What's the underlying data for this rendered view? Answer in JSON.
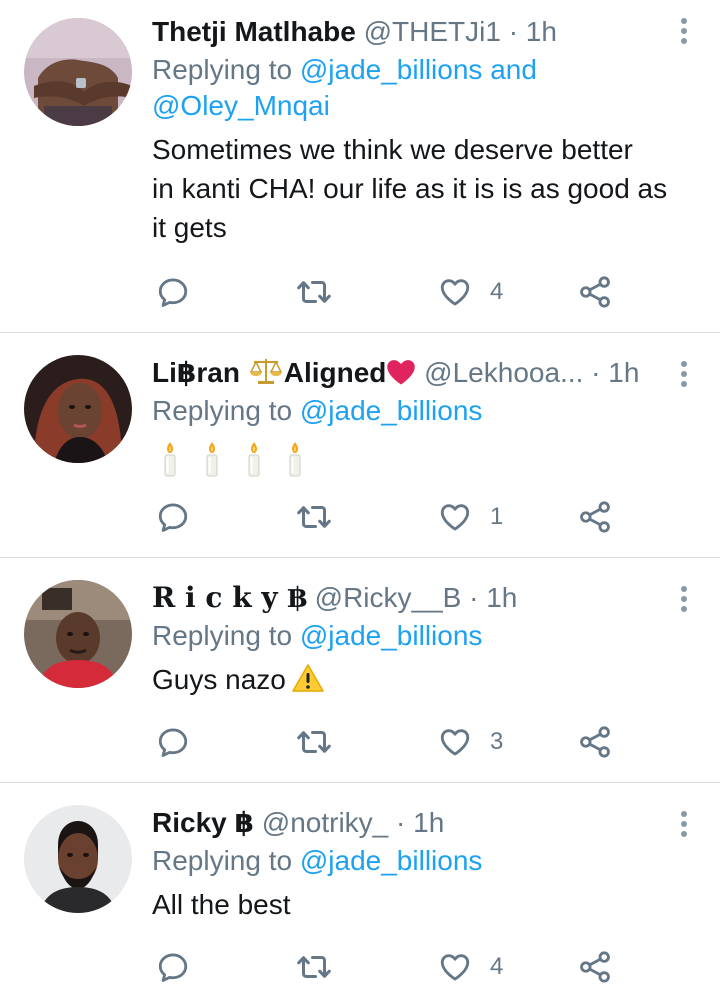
{
  "tweets": [
    {
      "name": "Thetji Matlhabe",
      "handle": "@THETJi1",
      "sep": "·",
      "time": "1h",
      "reply_prefix": "Replying to",
      "mentions_line1": "@jade_billions and",
      "mentions_line2": "@Oley_Mnqai",
      "text_lines": [
        "Sometimes we think we deserve better",
        "in kanti CHA! our life as it is is as good as",
        "it gets"
      ],
      "likes": "4"
    },
    {
      "name_part1": "Li฿ran",
      "name_part2": "Aligned",
      "handle": "@Lekhooa...",
      "sep": "·",
      "time": "1h",
      "reply_prefix": "Replying to",
      "mention": "@jade_billions",
      "likes": "1"
    },
    {
      "name": "R i c k y ฿",
      "handle": "@Ricky__B",
      "sep": "·",
      "time": "1h",
      "reply_prefix": "Replying to",
      "mention": "@jade_billions",
      "text": "Guys nazo",
      "likes": "3"
    },
    {
      "name": "Ricky ฿",
      "handle": "@notriky_",
      "sep": "·",
      "time": "1h",
      "reply_prefix": "Replying to",
      "mention": "@jade_billions",
      "text": "All the best",
      "likes": "4"
    }
  ],
  "colors": {
    "link": "#1da1f2",
    "muted": "#657786",
    "divider": "#d7dde2",
    "heart": "#e0245e"
  },
  "icons": [
    "reply-icon",
    "retweet-icon",
    "like-icon",
    "share-icon",
    "more-icon",
    "scales-emoji",
    "heart-emoji",
    "candle-emoji",
    "warning-emoji"
  ]
}
